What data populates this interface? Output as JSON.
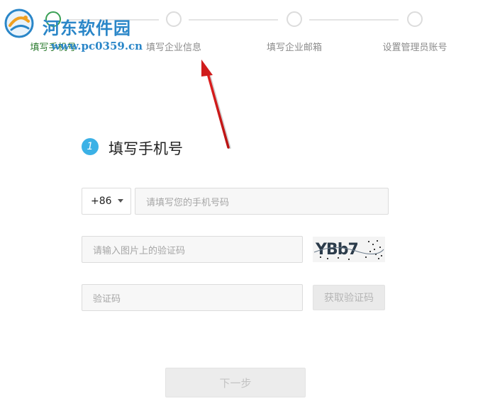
{
  "watermark": {
    "title": "河东软件园",
    "url": "www.pc0359.cn"
  },
  "stepper": {
    "steps": [
      {
        "label": "填写手机号",
        "active": true
      },
      {
        "label": "填写企业信息",
        "active": false
      },
      {
        "label": "填写企业邮箱",
        "active": false
      },
      {
        "label": "设置管理员账号",
        "active": false
      }
    ]
  },
  "section": {
    "number": "1",
    "title": "填写手机号"
  },
  "form": {
    "country_code": "+86",
    "phone_placeholder": "请填写您的手机号码",
    "captcha_placeholder": "请输入图片上的验证码",
    "captcha_text": "YBb7",
    "sms_code_placeholder": "验证码",
    "get_code_label": "获取验证码",
    "next_label": "下一步"
  },
  "colors": {
    "accent_blue": "#3bb1e6",
    "active_step": "#3aa055",
    "arrow_red": "#d01c1c",
    "watermark_blue": "#2a86c8"
  }
}
